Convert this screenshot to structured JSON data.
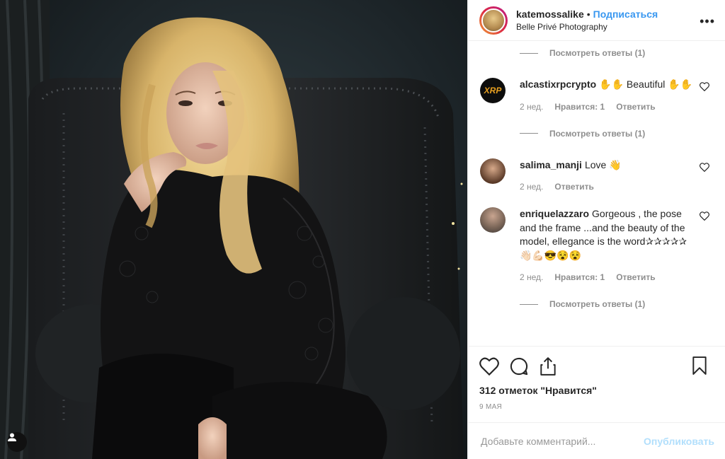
{
  "header": {
    "username": "katemossalike",
    "separator": "•",
    "follow_label": "Подписаться",
    "location": "Belle Privé Photography",
    "more_icon": "more-horizontal-icon"
  },
  "comments": [
    {
      "type": "replies",
      "label": "Посмотреть ответы (1)"
    },
    {
      "type": "comment",
      "user": "alcastixrpcrypto",
      "text": "✋✋ Beautiful ✋✋",
      "time": "2 нед.",
      "likes": "Нравится: 1",
      "reply": "Ответить",
      "avatar": "xrp-logo"
    },
    {
      "type": "replies",
      "label": "Посмотреть ответы (1)"
    },
    {
      "type": "comment",
      "user": "salima_manji",
      "text": "Love 👋",
      "time": "2 нед.",
      "likes": "",
      "reply": "Ответить",
      "avatar": "woman-portrait"
    },
    {
      "type": "comment",
      "user": "enriquelazzaro",
      "text": "Gorgeous , the pose and the frame ...and the beauty of the model, ellegance is the word✰✰✰✰✰👋🏻💪🏻😎😵😵",
      "time": "2 нед.",
      "likes": "Нравится: 1",
      "reply": "Ответить",
      "avatar": "man-portrait"
    },
    {
      "type": "replies",
      "label": "Посмотреть ответы (1)"
    }
  ],
  "actions": {
    "like_icon": "heart-icon",
    "comment_icon": "comment-icon",
    "share_icon": "share-icon",
    "save_icon": "bookmark-icon"
  },
  "likes_text": "312 отметок \"Нравится\"",
  "date_text": "9 МАЯ",
  "add_comment": {
    "placeholder": "Добавьте комментарий...",
    "publish_label": "Опубликовать"
  },
  "colors": {
    "accent": "#3897f0",
    "publish_disabled": "#b2dffc",
    "muted": "#8e8e8e"
  }
}
